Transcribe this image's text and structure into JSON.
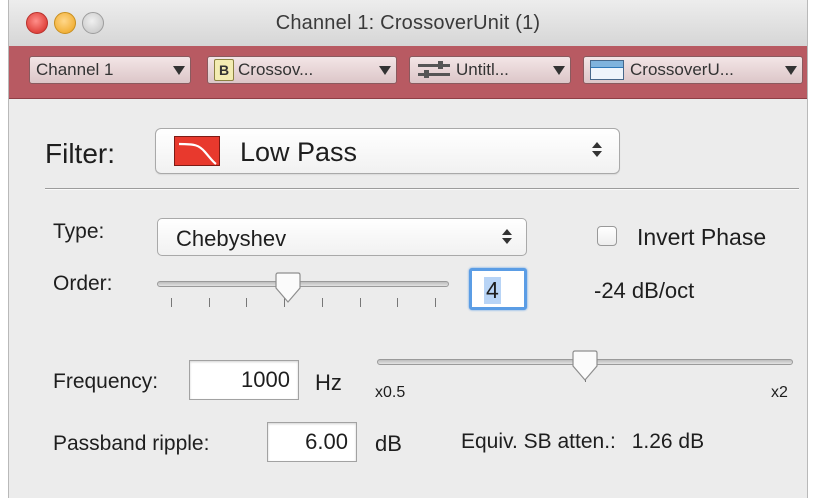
{
  "window": {
    "title": "Channel 1: CrossoverUnit (1)"
  },
  "toolbar": {
    "channel": "Channel 1",
    "plugin_badge": "B",
    "plugin": "Crossov...",
    "preset": "Untitl...",
    "view": "CrossoverU..."
  },
  "filter": {
    "label": "Filter:",
    "value": "Low Pass",
    "icon": "low-pass-curve-icon",
    "icon_color": "#e8392d"
  },
  "type": {
    "label": "Type:",
    "value": "Chebyshev"
  },
  "invert_phase": {
    "label": "Invert Phase",
    "checked": false
  },
  "order": {
    "label": "Order:",
    "value": "4",
    "slider_fraction": 0.45,
    "tick_count": 8,
    "slope": "-24 dB/oct"
  },
  "frequency": {
    "label": "Frequency:",
    "value": "1000",
    "unit": "Hz",
    "slider_min_label": "x0.5",
    "slider_max_label": "x2",
    "slider_fraction": 0.5
  },
  "passband": {
    "label": "Passband ripple:",
    "value": "6.00",
    "unit": "dB"
  },
  "stopband": {
    "label": "Equiv. SB atten.:",
    "value": "1.26 dB"
  },
  "colors": {
    "toolbar": "#b85a62",
    "focus_ring": "#5b9de5"
  }
}
